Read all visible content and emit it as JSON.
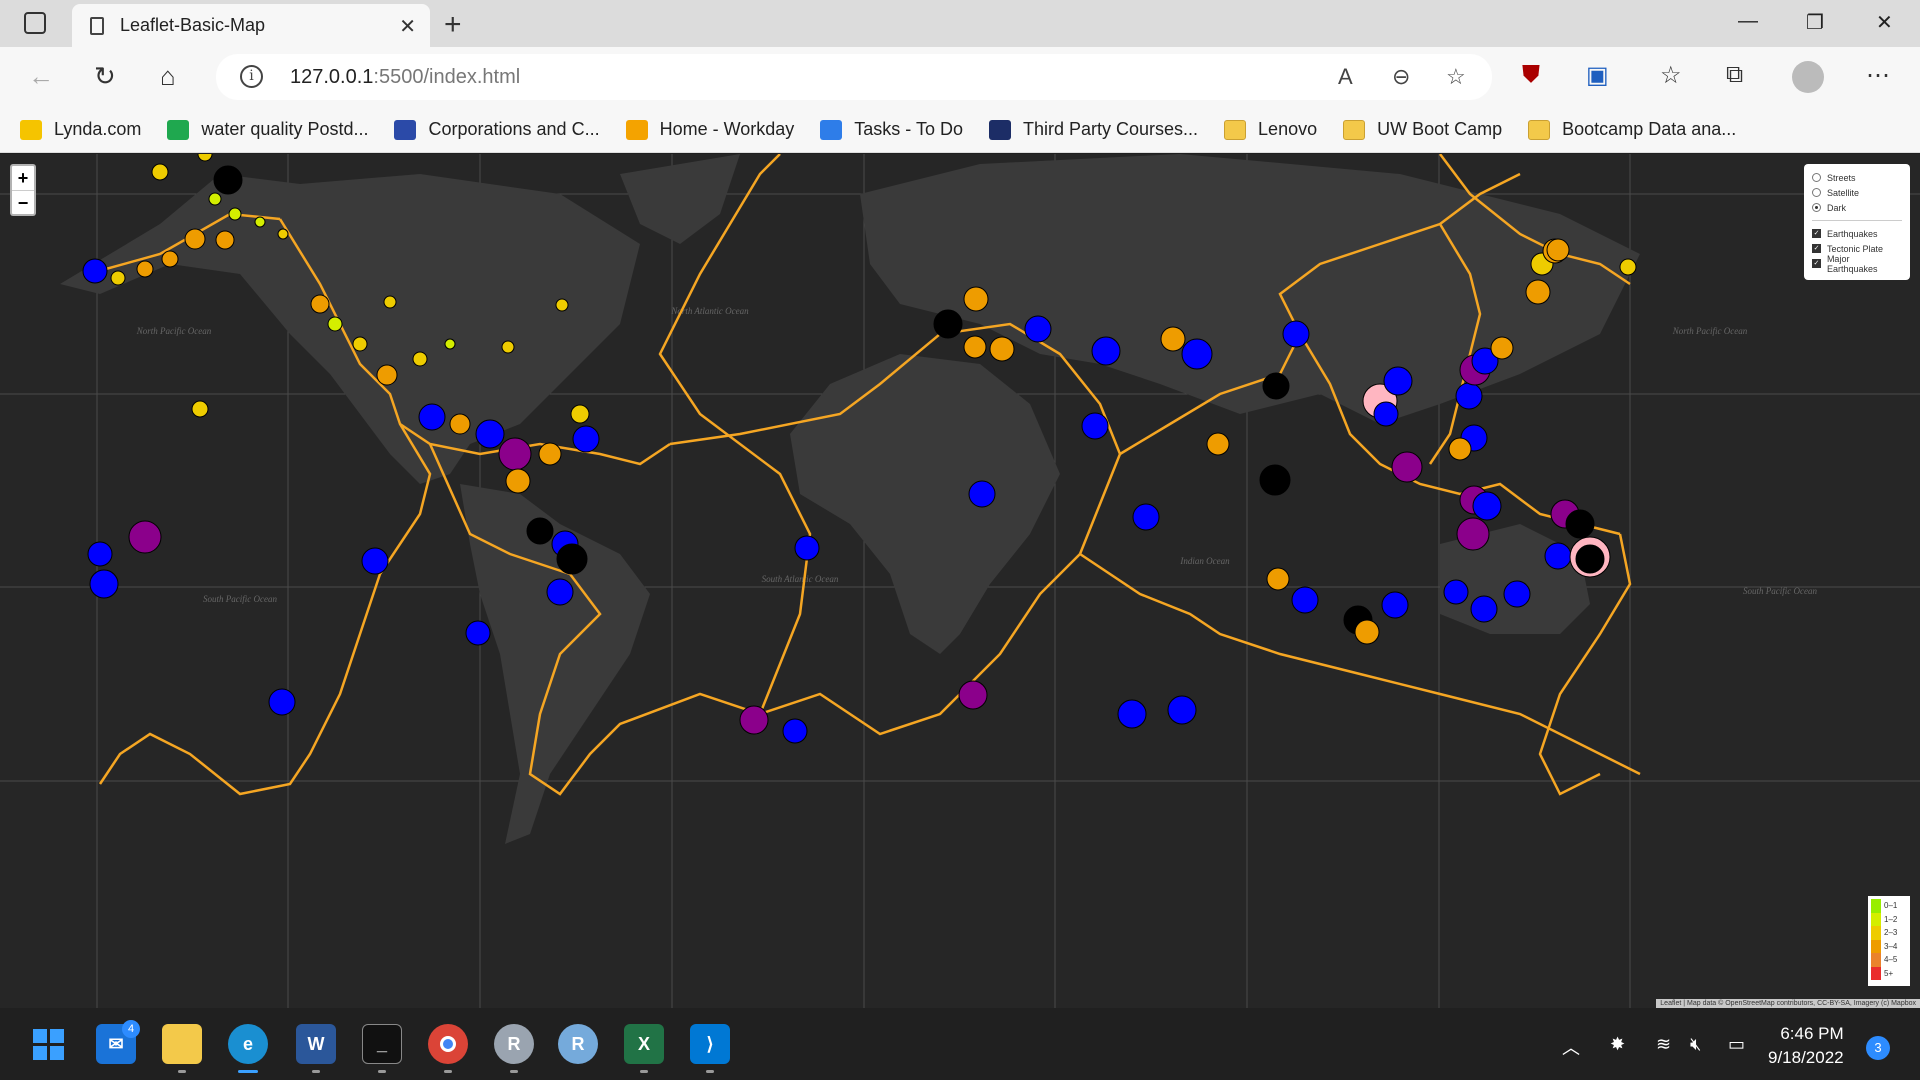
{
  "browser": {
    "tab_title": "Leaflet-Basic-Map",
    "url_prefix": "127.0.0.1",
    "url_suffix": ":5500/index.html"
  },
  "bookmarks": [
    {
      "label": "Lynda.com",
      "icon": "lynda-icon",
      "color": "#f5c400"
    },
    {
      "label": "water quality Postd...",
      "icon": "sheet-icon",
      "color": "#1fa84f"
    },
    {
      "label": "Corporations and C...",
      "icon": "flag-icon",
      "color": "#2b4aa8"
    },
    {
      "label": "Home - Workday",
      "icon": "workday-icon",
      "color": "#f4a300"
    },
    {
      "label": "Tasks - To Do",
      "icon": "check-icon",
      "color": "#2e7de9"
    },
    {
      "label": "Third Party Courses...",
      "icon": "b-icon",
      "color": "#1c2d66"
    },
    {
      "label": "Lenovo",
      "icon": "folder-icon",
      "color": "#f3c94a"
    },
    {
      "label": "UW Boot Camp",
      "icon": "folder-icon",
      "color": "#f3c94a"
    },
    {
      "label": "Bootcamp Data ana...",
      "icon": "folder-icon",
      "color": "#f3c94a"
    }
  ],
  "map": {
    "zoom_in": "+",
    "zoom_out": "−",
    "layers": {
      "base": [
        {
          "label": "Streets",
          "checked": false
        },
        {
          "label": "Satellite",
          "checked": false
        },
        {
          "label": "Dark",
          "checked": true
        }
      ],
      "overlays": [
        {
          "label": "Earthquakes",
          "checked": true
        },
        {
          "label": "Tectonic Plate",
          "checked": true
        },
        {
          "label": "Major Earthquakes",
          "checked": true
        }
      ]
    },
    "legend": [
      {
        "label": "0–1",
        "color": "#98ee00"
      },
      {
        "label": "1–2",
        "color": "#d4ee00"
      },
      {
        "label": "2–3",
        "color": "#eecc00"
      },
      {
        "label": "3–4",
        "color": "#ee9c00"
      },
      {
        "label": "4–5",
        "color": "#ea822c"
      },
      {
        "label": "5+",
        "color": "#ea2c2c"
      }
    ],
    "attribution": "Leaflet | Map data © OpenStreetMap contributors, CC-BY-SA, Imagery (c) Mapbox",
    "ocean_labels": [
      "North Pacific Ocean",
      "North Atlantic Ocean",
      "South Pacific Ocean",
      "South Atlantic Ocean",
      "Indian Ocean",
      "North Pacific Ocean",
      "South Pacific Ocean"
    ],
    "colors": {
      "plates": "#f5a623",
      "land": "#3a3a3a",
      "ocean": "#262626"
    }
  },
  "taskbar": {
    "apps": [
      "start",
      "mail",
      "explorer",
      "edge",
      "word",
      "terminal",
      "chrome",
      "r-console",
      "rstudio",
      "excel",
      "vscode"
    ],
    "mail_badge": "4",
    "time": "6:46 PM",
    "date": "9/18/2022",
    "notification_count": "3"
  }
}
